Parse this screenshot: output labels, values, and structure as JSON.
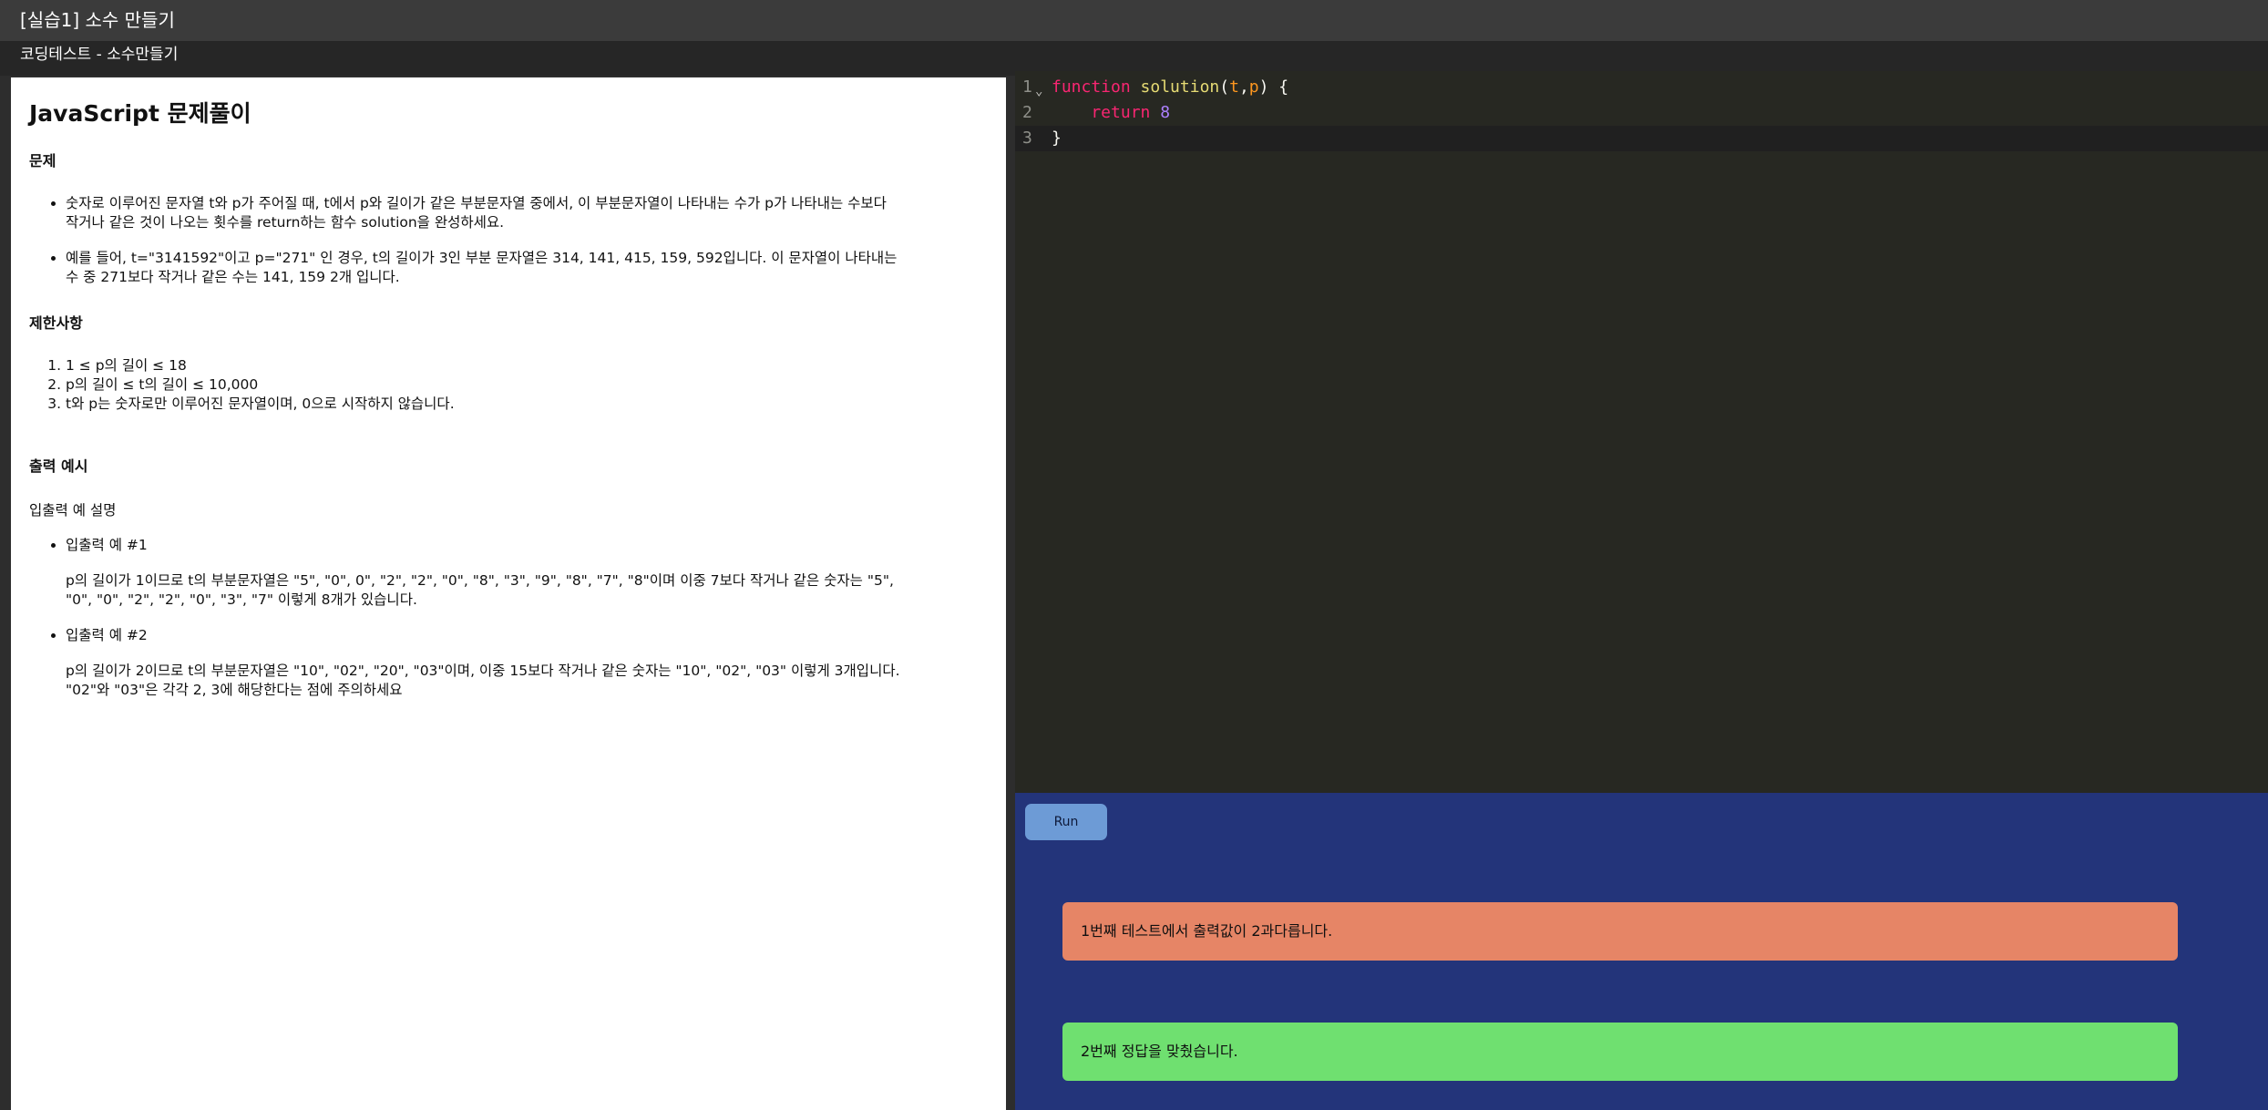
{
  "window": {
    "title": "[실습1] 소수 만들기"
  },
  "subheader": {
    "title": "코딩테스트 - 소수만들기"
  },
  "problem": {
    "heading": "JavaScript 문제풀이",
    "sections": {
      "problem_label": "문제",
      "constraints_label": "제한사항",
      "output_label": "출력 예시",
      "io_desc_label": "입출력 예 설명"
    },
    "bullets": [
      "숫자로 이루어진 문자열 t와 p가 주어질 때, t에서 p와 길이가 같은 부분문자열 중에서, 이 부분문자열이 나타내는 수가 p가 나타내는 수보다 작거나 같은 것이 나오는 횟수를 return하는 함수 solution을 완성하세요.",
      "예를 들어, t=\"3141592\"이고 p=\"271\" 인 경우, t의 길이가 3인 부분 문자열은 314, 141, 415, 159, 592입니다. 이 문자열이 나타내는 수 중 271보다 작거나 같은 수는 141, 159 2개 입니다."
    ],
    "constraints": [
      "1 ≤ p의 길이 ≤ 18",
      "p의 길이 ≤ t의 길이 ≤ 10,000",
      "t와 p는 숫자로만 이루어진 문자열이며, 0으로 시작하지 않습니다."
    ],
    "examples": [
      {
        "title": "입출력 예 #1",
        "desc": "p의 길이가 1이므로 t의 부분문자열은 \"5\", \"0\", 0\", \"2\", \"2\", \"0\", \"8\", \"3\", \"9\", \"8\", \"7\", \"8\"이며 이중 7보다 작거나 같은 숫자는 \"5\", \"0\", \"0\", \"2\", \"2\", \"0\", \"3\", \"7\" 이렇게 8개가 있습니다."
      },
      {
        "title": "입출력 예 #2",
        "desc": "p의 길이가 2이므로 t의 부분문자열은 \"10\", \"02\", \"20\", \"03\"이며, 이중 15보다 작거나 같은 숫자는 \"10\", \"02\", \"03\" 이렇게 3개입니다. \"02\"와 \"03\"은 각각 2, 3에 해당한다는 점에 주의하세요"
      }
    ]
  },
  "editor": {
    "lines": [
      {
        "num": "1",
        "tokens": [
          {
            "t": "function",
            "c": "kw"
          },
          {
            "t": " ",
            "c": "punc"
          },
          {
            "t": "solution",
            "c": "fname"
          },
          {
            "t": "(",
            "c": "punc"
          },
          {
            "t": "t",
            "c": "param"
          },
          {
            "t": ",",
            "c": "punc"
          },
          {
            "t": "p",
            "c": "param"
          },
          {
            "t": ") {",
            "c": "punc"
          }
        ]
      },
      {
        "num": "2",
        "tokens": [
          {
            "t": "    return",
            "c": "kw"
          },
          {
            "t": " ",
            "c": "punc"
          },
          {
            "t": "8",
            "c": "num"
          }
        ]
      },
      {
        "num": "3",
        "tokens": [
          {
            "t": "}",
            "c": "punc"
          }
        ]
      }
    ],
    "fold_icon": "chevron-down-icon",
    "theme_colors": {
      "background": "#272822",
      "keyword": "#f92672",
      "function_name": "#e6db74",
      "param": "#fd971f",
      "number": "#ae81ff"
    }
  },
  "results": {
    "run_label": "Run",
    "messages": [
      {
        "text": "1번째 테스트에서 출력값이 2과다릅니다.",
        "status": "fail",
        "color": "#e68566"
      },
      {
        "text": "2번째 정답을 맞췄습니다.",
        "status": "pass",
        "color": "#6fe070"
      }
    ],
    "panel_color": "#23347a"
  }
}
